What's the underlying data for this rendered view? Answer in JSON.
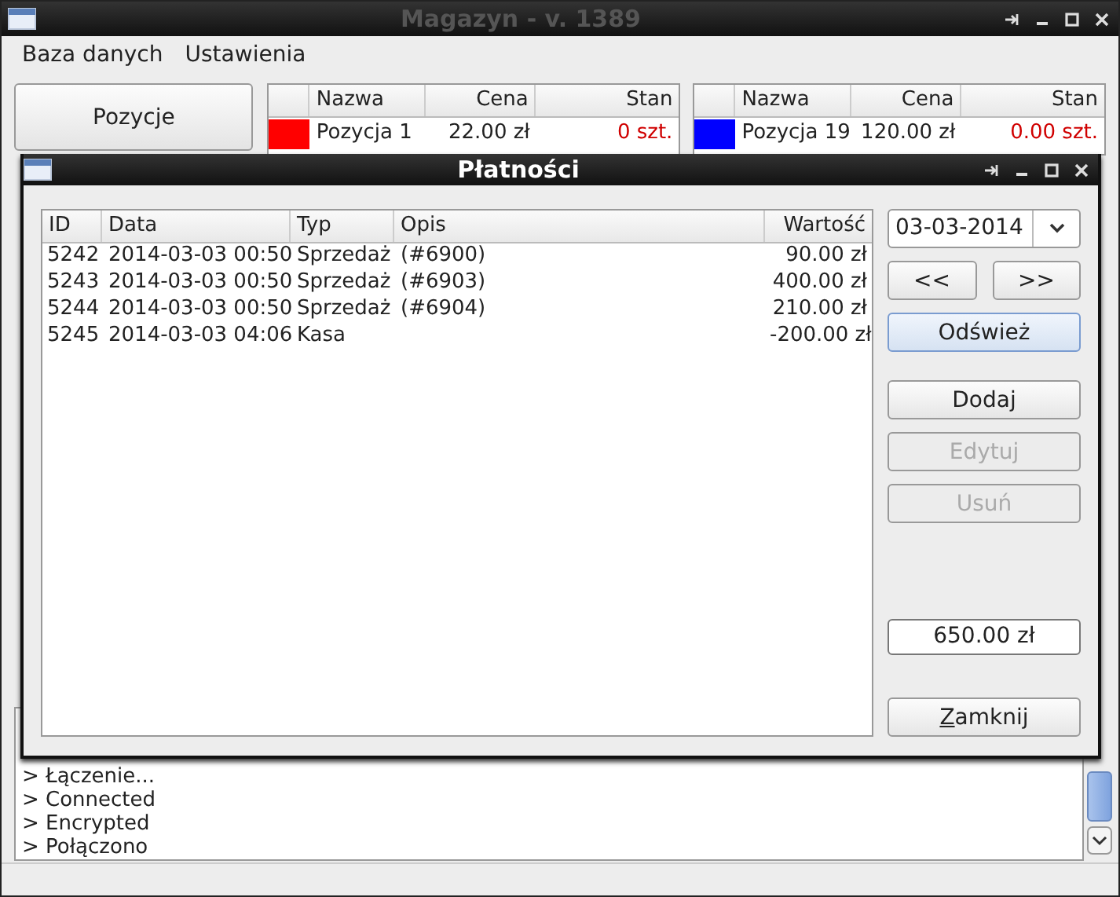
{
  "main_window": {
    "title": "Magazyn - v. 1389",
    "menu": [
      "Baza danych",
      "Ustawienia"
    ],
    "positions_button": "Pozycje",
    "tables": [
      {
        "columns": [
          "Nazwa",
          "Cena",
          "Stan"
        ],
        "rows": [
          {
            "color": "#ff0000",
            "name": "Pozycja 1",
            "price": "22.00 zł",
            "stock": "0 szt."
          }
        ]
      },
      {
        "columns": [
          "Nazwa",
          "Cena",
          "Stan"
        ],
        "rows": [
          {
            "color": "#0000ff",
            "name": "Pozycja 19",
            "price": "120.00 zł",
            "stock": "0.00 szt."
          }
        ]
      }
    ],
    "log": [
      "> Łączenie...",
      "> Connected",
      "> Encrypted",
      "> Połączono"
    ]
  },
  "dialog": {
    "title": "Płatności",
    "table": {
      "columns": [
        "ID",
        "Data",
        "Typ",
        "Opis",
        "Wartość"
      ],
      "rows": [
        {
          "id": "5242",
          "date": "2014-03-03 00:50",
          "type": "Sprzedaż",
          "description": "(#6900)",
          "value": "90.00 zł"
        },
        {
          "id": "5243",
          "date": "2014-03-03 00:50",
          "type": "Sprzedaż",
          "description": "(#6903)",
          "value": "400.00 zł"
        },
        {
          "id": "5244",
          "date": "2014-03-03 00:50",
          "type": "Sprzedaż",
          "description": "(#6904)",
          "value": "210.00 zł"
        },
        {
          "id": "5245",
          "date": "2014-03-03 04:06",
          "type": "Kasa",
          "value": "-200.00 zł"
        }
      ]
    },
    "date": "03-03-2014",
    "nav_buttons": [
      "<<",
      ">>"
    ],
    "refresh": {
      "label": "Odśwież",
      "focused": true
    },
    "actions": [
      {
        "label": "Dodaj",
        "disabled": false
      },
      {
        "label": "Edytuj",
        "disabled": true
      },
      {
        "label": "Usuń",
        "disabled": true
      }
    ],
    "total": "650.00 zł",
    "close": {
      "label": "Zamknij",
      "mnemonic_first_letter": true
    }
  }
}
